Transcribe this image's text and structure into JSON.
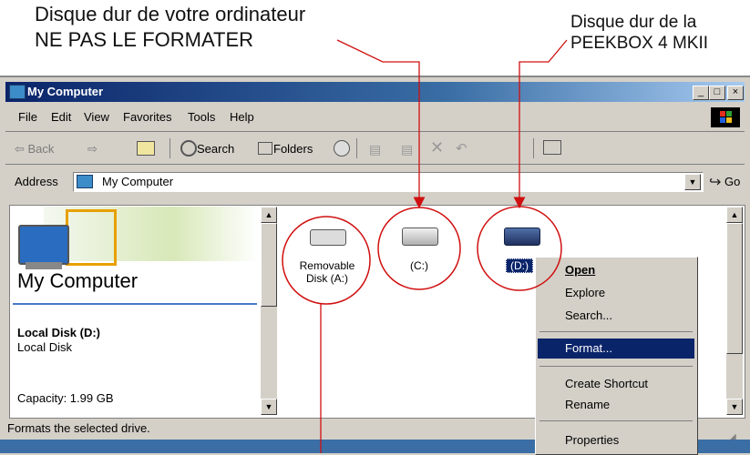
{
  "annotations": {
    "top_left": [
      "Disque dur de votre ordinateur",
      "NE PAS LE FORMATER"
    ],
    "top_right": [
      "Disque dur de la",
      "PEEKBOX 4 MKII"
    ]
  },
  "window": {
    "title": "My Computer",
    "min_btn": "_",
    "max_btn": "□",
    "close_btn": "×"
  },
  "menu": [
    "File",
    "Edit",
    "View",
    "Favorites",
    "Tools",
    "Help"
  ],
  "toolbar": {
    "back": "⇦ Back",
    "forward": "⇨",
    "search": "Search",
    "folders": "Folders"
  },
  "address": {
    "label": "Address",
    "value": "My Computer",
    "go": "Go"
  },
  "left_pane": {
    "heading": "My Computer",
    "drive_title": "Local Disk (D:)",
    "drive_type": "Local Disk",
    "capacity": "Capacity: 1.99 GB"
  },
  "drives": [
    {
      "label_line1": "Removable",
      "label_line2": "Disk (A:)"
    },
    {
      "label_line1": "(C:)",
      "label_line2": ""
    },
    {
      "label_line1": "(D:)",
      "label_line2": ""
    }
  ],
  "context_menu": {
    "open": "Open",
    "explore": "Explore",
    "search": "Search...",
    "format": "Format...",
    "create_shortcut": "Create Shortcut",
    "rename": "Rename",
    "properties": "Properties"
  },
  "status": {
    "text": "Formats the selected drive."
  },
  "colors": {
    "annotation_line": "#d01010",
    "titlebar": "#0a246a",
    "highlight": "#0a246a"
  }
}
